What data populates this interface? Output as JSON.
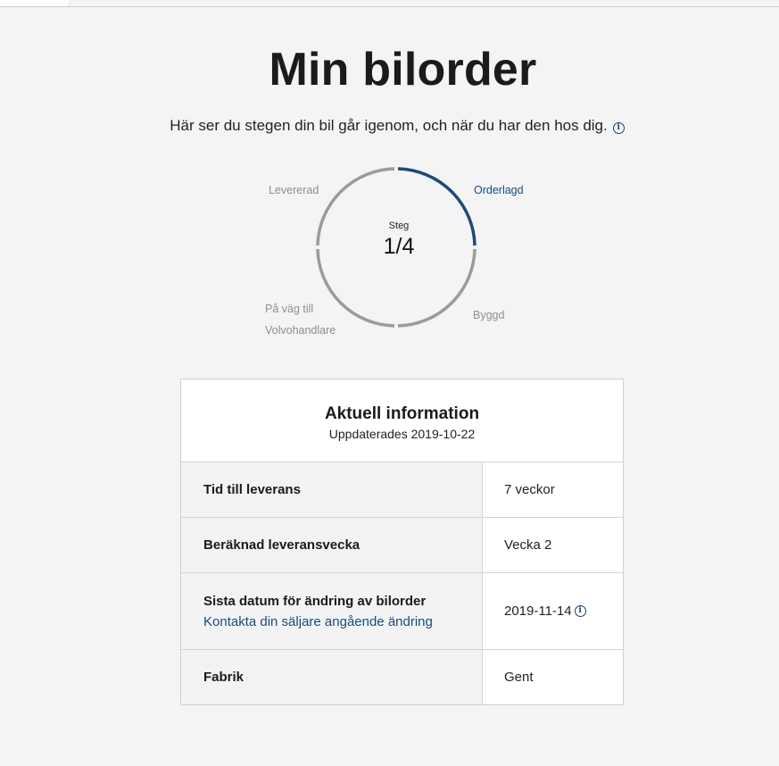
{
  "page": {
    "title": "Min bilorder",
    "subtitle": "Här ser du stegen din bil går igenom, och när du har den hos dig."
  },
  "progress": {
    "center_label": "Steg",
    "center_value": "1/4",
    "current_step": 1,
    "total_steps": 4,
    "active_color": "#1c4a7b",
    "inactive_color": "#9b9b9b",
    "steps": [
      {
        "label": "Orderlagd",
        "active": true
      },
      {
        "label": "Byggd",
        "active": false
      },
      {
        "label_line1": "På väg till",
        "label_line2": "Volvohandlare",
        "active": false
      },
      {
        "label": "Levererad",
        "active": false
      }
    ]
  },
  "info_card": {
    "title": "Aktuell information",
    "updated": "Uppdaterades 2019-10-22",
    "rows": [
      {
        "label": "Tid till leverans",
        "value": "7 veckor"
      },
      {
        "label": "Beräknad leveransvecka",
        "value": "Vecka 2"
      },
      {
        "label": "Sista datum för ändring av bilorder",
        "link": "Kontakta din säljare angående ändring",
        "value": "2019-11-14"
      },
      {
        "label": "Fabrik",
        "value": "Gent"
      }
    ]
  },
  "icons": {
    "info": "info-icon"
  }
}
